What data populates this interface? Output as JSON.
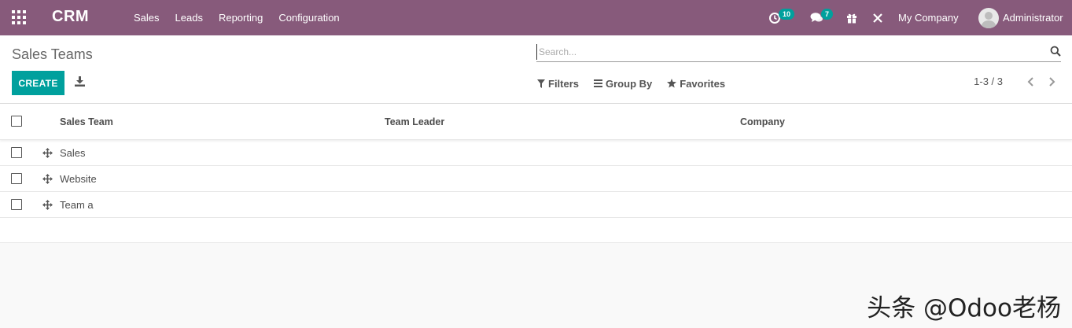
{
  "navbar": {
    "brand": "CRM",
    "menu": [
      "Sales",
      "Leads",
      "Reporting",
      "Configuration"
    ],
    "activity_count": "10",
    "message_count": "7",
    "company": "My Company",
    "user": "Administrator"
  },
  "control_panel": {
    "breadcrumb": "Sales Teams",
    "search_placeholder": "Search...",
    "create_label": "CREATE",
    "filters_label": "Filters",
    "group_by_label": "Group By",
    "favorites_label": "Favorites",
    "pager": "1-3 / 3"
  },
  "list": {
    "columns": [
      "Sales Team",
      "Team Leader",
      "Company"
    ],
    "rows": [
      {
        "name": "Sales"
      },
      {
        "name": "Website"
      },
      {
        "name": "Team a"
      }
    ]
  },
  "watermark": "头条 @Odoo老杨",
  "colors": {
    "navbar": "#875a7b",
    "primary": "#00a09d"
  }
}
